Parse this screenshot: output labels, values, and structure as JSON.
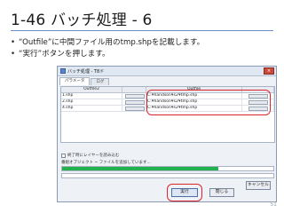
{
  "slide": {
    "title": "1-46 バッチ処理 - 6",
    "bullets": [
      "“Outfile”に中間ファイル用のtmp.shpを記載します。",
      "“実行”ボタンを押します。"
    ],
    "page_number": "51"
  },
  "dialog": {
    "title": "バッチ処理 - T8ド",
    "close_glyph": "×",
    "tabs": [
      "パラメータ",
      "ログ"
    ],
    "table": {
      "columns": [
        "Outfile2",
        "",
        "Outfile",
        ""
      ],
      "rows": [
        {
          "input": "1.shp",
          "output": "C:¥handson¥s2¥tmp.shp"
        },
        {
          "input": "2.shp",
          "output": "C:¥handson¥s2¥tmp.shp"
        },
        {
          "input": "4.shp",
          "output": "C:¥handson¥s2¥tmp.shp"
        }
      ]
    },
    "checkbox_label": "終了時にレイヤーを読み込む",
    "status_text": "番組オブジェクト ~ ファイルを追加しています...",
    "progress_fraction": 0.74,
    "buttons": {
      "run": "実行",
      "close": "閉じる",
      "cancel": "キャンセル"
    }
  },
  "colors": {
    "highlight": "#d9262c",
    "progress": "#22b14c",
    "title_rule": "#6b8fc5"
  }
}
